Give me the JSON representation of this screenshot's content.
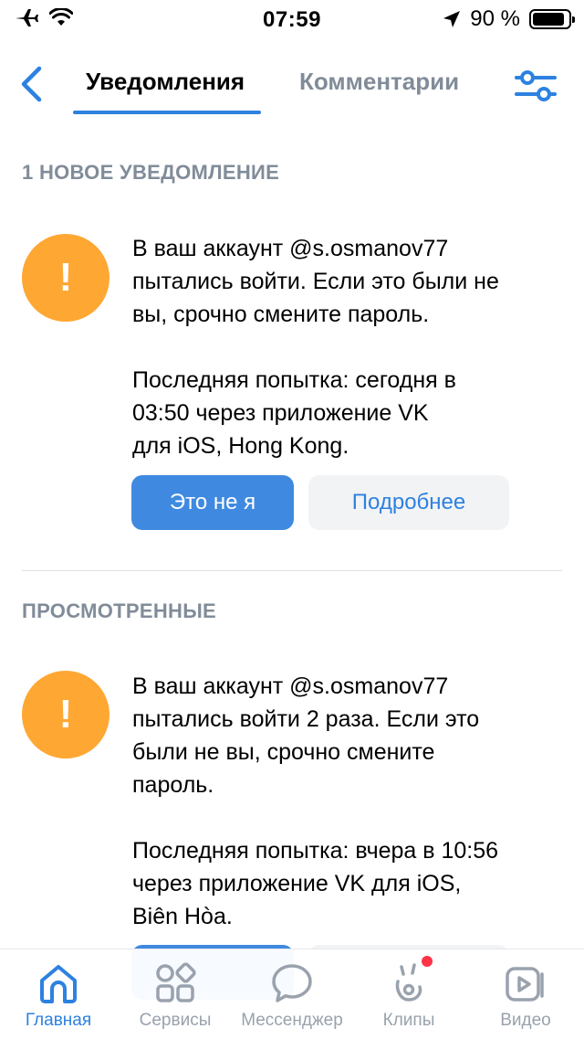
{
  "status_bar": {
    "time": "07:59",
    "battery_percent_text": "90 %",
    "battery_level": 0.9
  },
  "header": {
    "tabs": [
      {
        "label": "Уведомления",
        "active": true
      },
      {
        "label": "Комментарии",
        "active": false
      }
    ]
  },
  "sections": {
    "new_title": "1 НОВОЕ УВЕДОМЛЕНИЕ",
    "viewed_title": "ПРОСМОТРЕННЫЕ"
  },
  "notifications": [
    {
      "icon": "exclamation-icon",
      "lines_main": [
        "В ваш аккаунт @s.osmanov77",
        "пытались войти. Если это были не",
        "вы, срочно смените пароль."
      ],
      "lines_detail": [
        "Последняя попытка: сегодня в",
        "03:50 через приложение VK",
        "для iOS, Hong Kong."
      ],
      "primary_button": "Это не я",
      "secondary_button": "Подробнее"
    },
    {
      "icon": "exclamation-icon",
      "lines_main": [
        "В ваш аккаунт @s.osmanov77",
        "пытались войти 2 раза. Если это",
        "были не вы, срочно смените",
        "пароль."
      ],
      "lines_detail": [
        "Последняя попытка: вчера в 10:56",
        "через приложение VK для iOS,",
        "Biên Hòa."
      ]
    }
  ],
  "tabbar": [
    {
      "label": "Главная",
      "icon": "home-icon",
      "active": true
    },
    {
      "label": "Сервисы",
      "icon": "services-icon",
      "active": false
    },
    {
      "label": "Мессенджер",
      "icon": "messenger-icon",
      "active": false
    },
    {
      "label": "Клипы",
      "icon": "clips-icon",
      "active": false,
      "badge": true
    },
    {
      "label": "Видео",
      "icon": "video-icon",
      "active": false
    }
  ],
  "colors": {
    "accent": "#2d81e0",
    "button_primary": "#3f8ae0",
    "warning": "#ffa733",
    "secondary_text": "#818c99",
    "badge": "#ff3347"
  }
}
